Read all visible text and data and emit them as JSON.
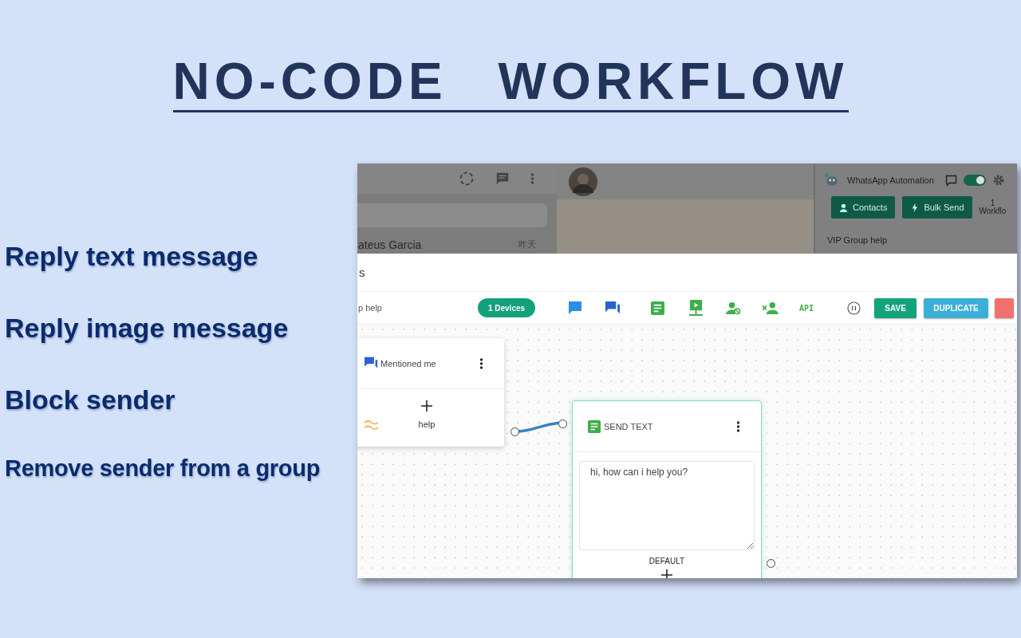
{
  "headline": "NO-CODE WORKFLOW",
  "features": [
    "Reply text message",
    "Reply image message",
    "Block sender",
    "Remove sender from a group"
  ],
  "whatsapp": {
    "chat_name": "ateus Garcia",
    "chat_time": "昨天",
    "automation_title": "WhatsApp Automation",
    "toggle_on": true,
    "buttons": [
      {
        "label": "Contacts",
        "kind": "contacts"
      },
      {
        "label": "Bulk Send",
        "kind": "bulk"
      }
    ],
    "workflow_count": "1",
    "workflow_label": "Workflo",
    "group_name": "VIP Group help"
  },
  "editor": {
    "title": "s",
    "workflow_name": "p help",
    "devices": "1 Devices",
    "api_label": "API",
    "buttons": [
      {
        "label": "SAVE",
        "kind": "save"
      },
      {
        "label": "DUPLICATE",
        "kind": "duplicate"
      },
      {
        "kind": "delete"
      }
    ]
  },
  "trigger_node": {
    "title": "Mentioned me",
    "keyword": "help"
  },
  "action_node": {
    "title": "SEND TEXT",
    "message": "hi, how can i help you?",
    "output": "DEFAULT"
  }
}
